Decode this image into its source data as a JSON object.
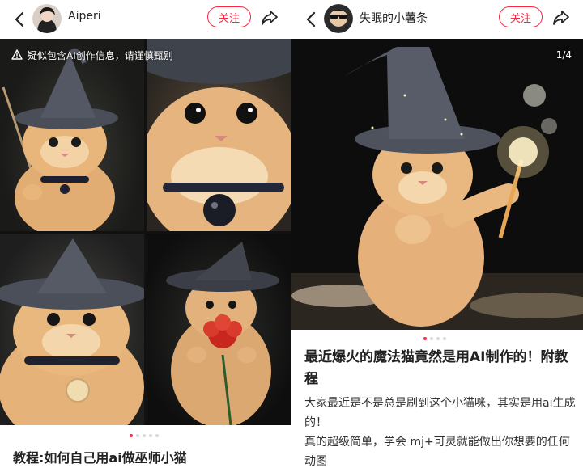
{
  "left_post": {
    "author": {
      "name": "Aiperi"
    },
    "follow_label": "关注",
    "ai_warning": "疑似包含AI创作信息，请谨慎甄别",
    "carousel": {
      "total": 5,
      "active": 0
    },
    "title": "教程:如何自己用ai做巫师小猫"
  },
  "right_post": {
    "author": {
      "name": "失眠的小薯条"
    },
    "follow_label": "关注",
    "page_counter": "1/4",
    "carousel": {
      "total": 4,
      "active": 0
    },
    "title": "最近爆火的魔法猫竟然是用AI制作的！附教程",
    "body": [
      "大家最近是不是总是刷到这个小猫咪，其实是用ai生成的！",
      "真的超级简单，学会 mj+可灵就能做出你想要的任何动图"
    ]
  },
  "colors": {
    "accent": "#ff2442",
    "text": "#222222",
    "cat_fur": "#e8b57a",
    "hat": "#4a4e58"
  },
  "icons": [
    "back-arrow-icon",
    "share-icon",
    "warning-triangle-icon"
  ]
}
